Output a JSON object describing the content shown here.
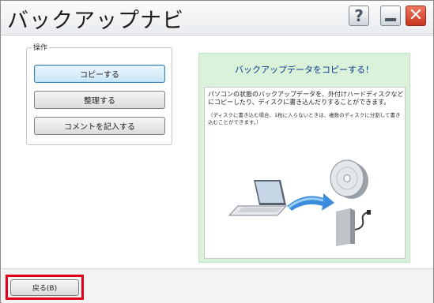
{
  "window": {
    "title": "バックアップナビ",
    "help_label": "?",
    "close_label": "✕"
  },
  "operations": {
    "legend": "操作",
    "buttons": [
      {
        "label": "コピーする",
        "state": "focused"
      },
      {
        "label": "整理する",
        "state": "normal"
      },
      {
        "label": "コメントを記入する",
        "state": "normal"
      }
    ]
  },
  "info_panel": {
    "title": "バックアップデータをコピーする！",
    "description": "パソコンの状態のバックアップデータを、外付けハードディスクなどにコピーしたり、ディスクに書き込んだりすることができます。",
    "note": "（ディスクに書き込む場合、1枚に入らないときは、複数のディスクに分割して書き込むことができます。）",
    "illustration": [
      "laptop-icon",
      "arrow-icon",
      "optical-disc-icon",
      "external-hard-disk-icon"
    ],
    "colors": {
      "background": "#daf2da",
      "title": "#0b3a8f"
    }
  },
  "footer": {
    "back_label": "戻る(B)",
    "highlight_color": "#e0001b"
  }
}
